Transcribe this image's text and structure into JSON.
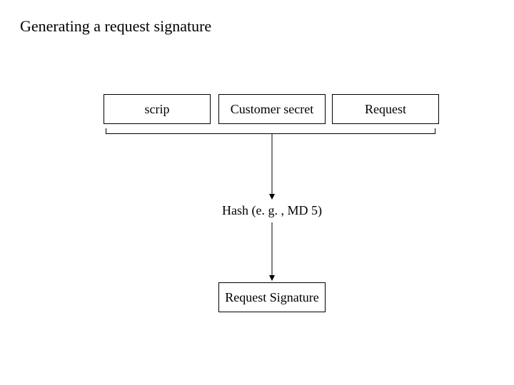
{
  "title": "Generating a request signature",
  "boxes": {
    "scrip": "scrip",
    "customer_secret": "Customer secret",
    "request": "Request",
    "request_signature": "Request Signature"
  },
  "hash_label": "Hash (e. g. , MD 5)"
}
